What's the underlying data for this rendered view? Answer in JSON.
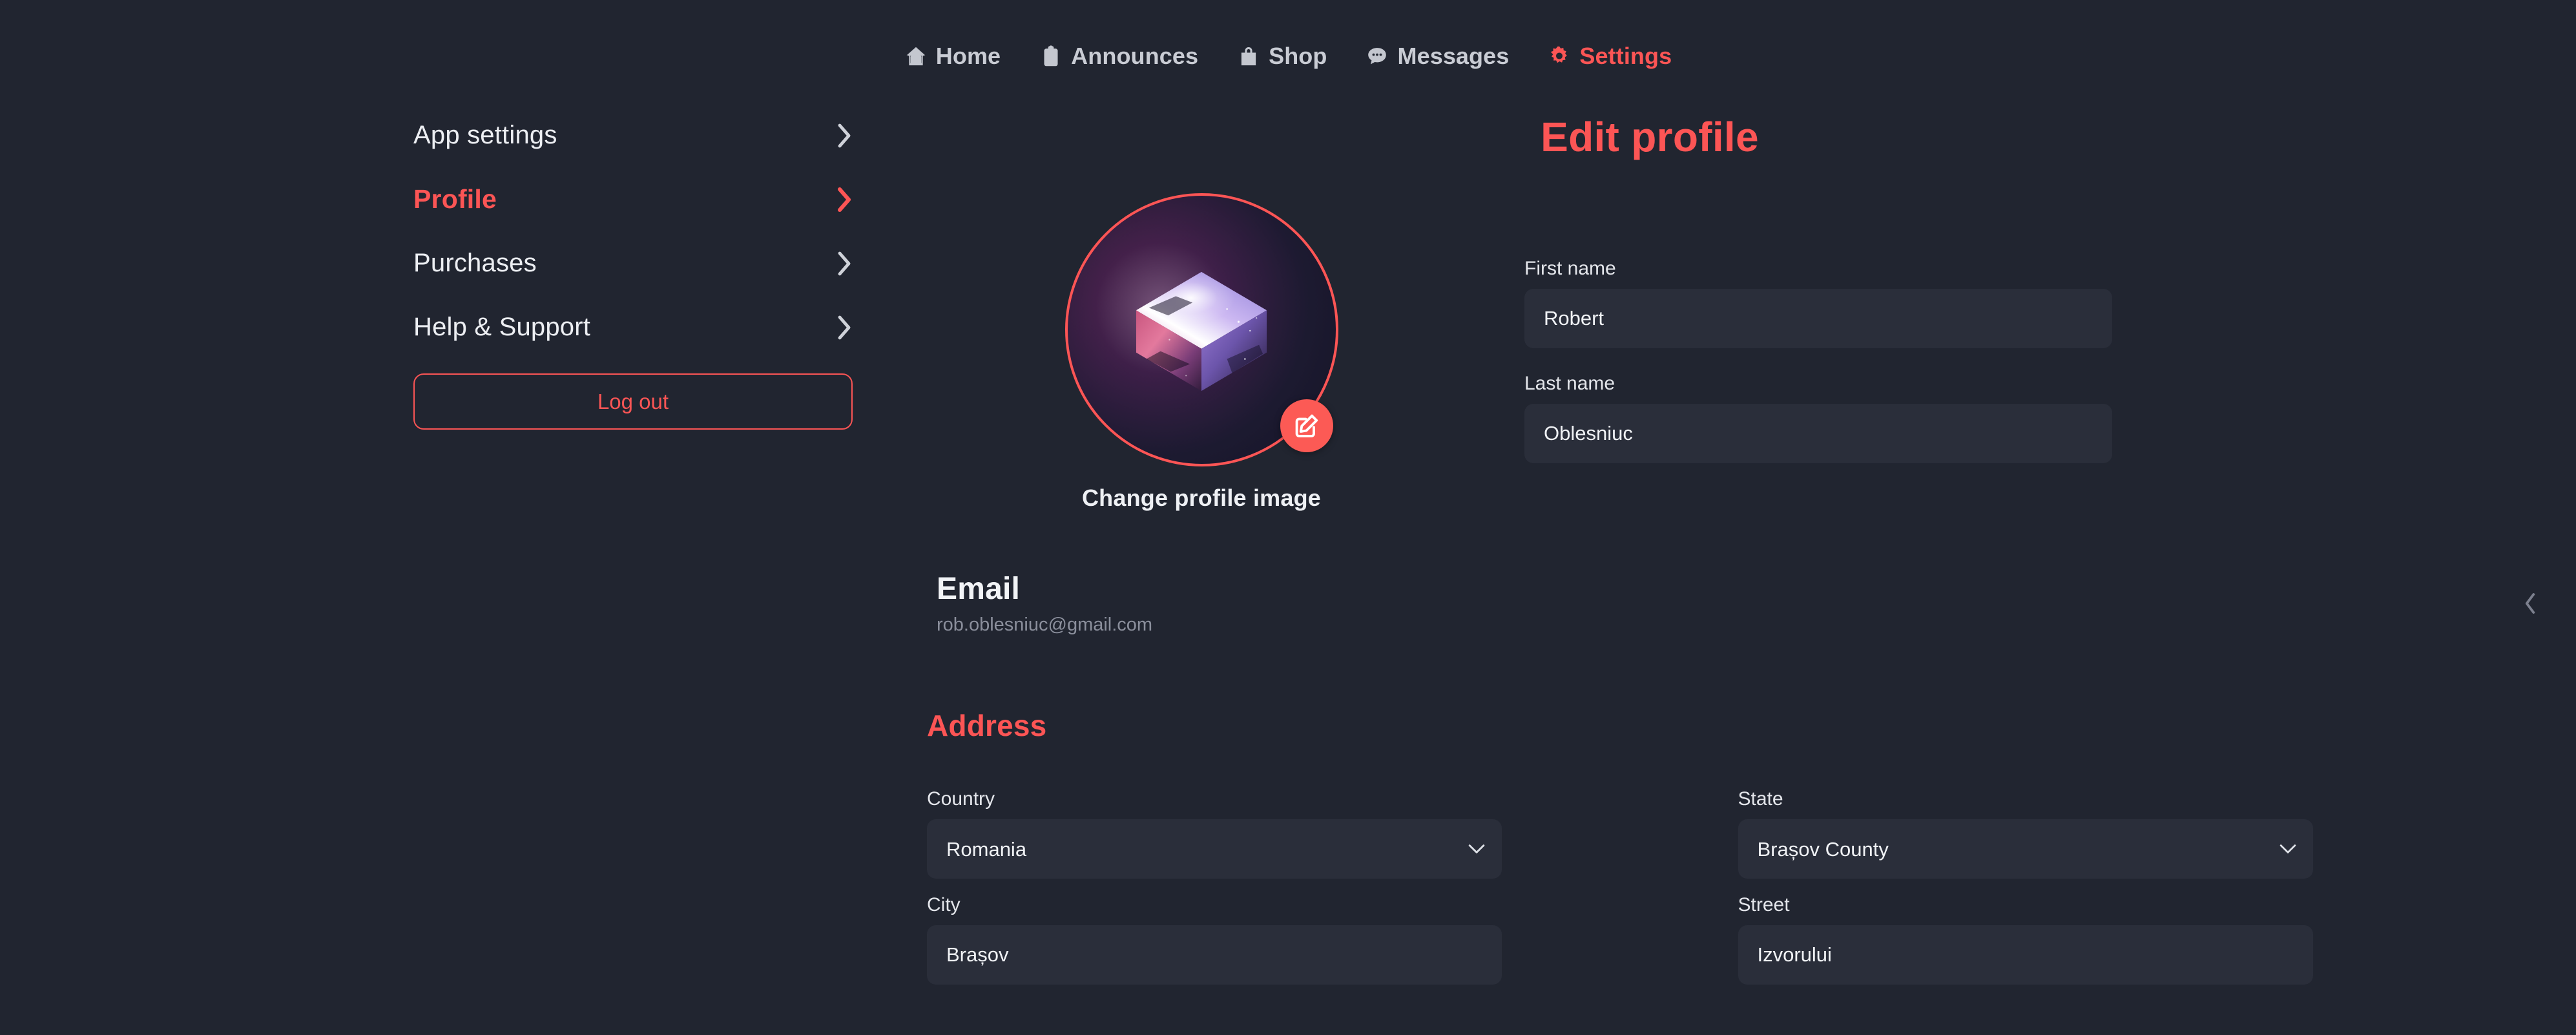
{
  "colors": {
    "background": "#212530",
    "accent": "#fc5555",
    "field_bg": "#2a2e3a",
    "text": "#eceef2",
    "muted": "#8b8f9c"
  },
  "topnav": {
    "items": [
      {
        "label": "Home",
        "icon": "home-icon",
        "active": false
      },
      {
        "label": "Announces",
        "icon": "clipboard-icon",
        "active": false
      },
      {
        "label": "Shop",
        "icon": "shopping-bag-icon",
        "active": false
      },
      {
        "label": "Messages",
        "icon": "chat-bubble-icon",
        "active": false
      },
      {
        "label": "Settings",
        "icon": "gear-icon",
        "active": true
      }
    ]
  },
  "sidebar": {
    "items": [
      {
        "label": "App settings",
        "active": false,
        "chevron": "chevron-right-icon"
      },
      {
        "label": "Profile",
        "active": true,
        "chevron": "chevron-right-icon"
      },
      {
        "label": "Purchases",
        "active": false,
        "chevron": "chevron-right-icon"
      },
      {
        "label": "Help & Support",
        "active": false,
        "chevron": "chevron-right-icon"
      }
    ],
    "logout_label": "Log out"
  },
  "main": {
    "page_title": "Edit profile",
    "avatar": {
      "caption": "Change profile image",
      "edit_icon": "edit-pencil-icon",
      "alt": "nebula cube profile picture"
    },
    "fields": {
      "first_name": {
        "label": "First name",
        "value": "Robert",
        "placeholder": "First name"
      },
      "last_name": {
        "label": "Last name",
        "value": "Oblesniuc",
        "placeholder": "Last name"
      }
    },
    "email": {
      "title": "Email",
      "value": "rob.oblesniuc@gmail.com",
      "chevron": "chevron-left-icon"
    },
    "address": {
      "title": "Address",
      "country": {
        "label": "Country",
        "value": "Romania",
        "options": [
          "Romania"
        ]
      },
      "state": {
        "label": "State",
        "value": "Brașov County",
        "options": [
          "Brașov County"
        ]
      },
      "city": {
        "label": "City",
        "value": "Brașov",
        "placeholder": "City"
      },
      "street": {
        "label": "Street",
        "value": "Izvorului",
        "placeholder": "Street"
      }
    }
  }
}
